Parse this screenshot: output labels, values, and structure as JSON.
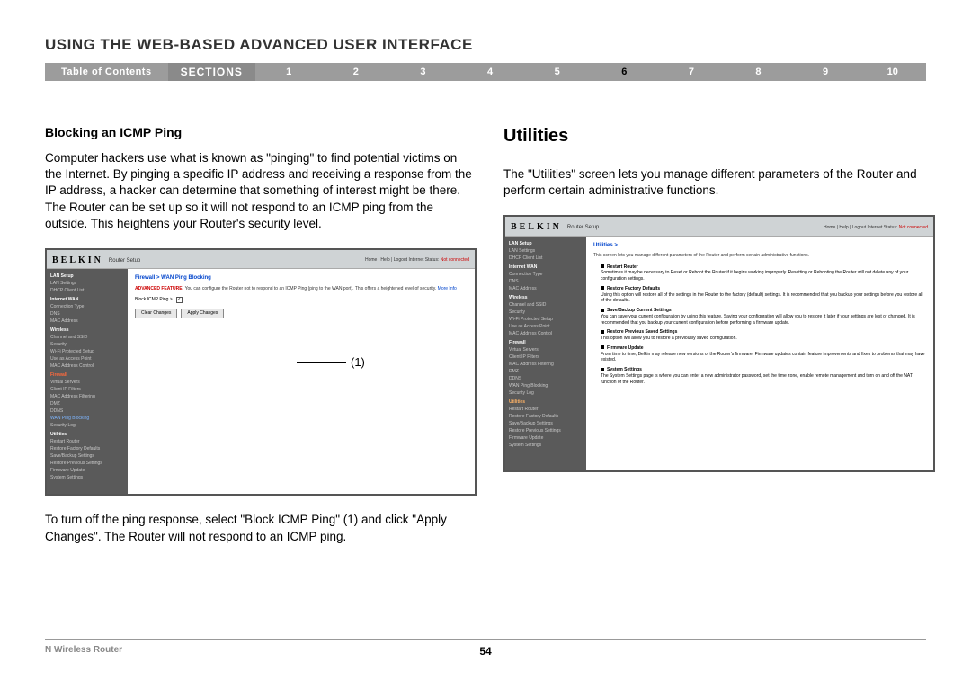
{
  "page_title": "USING THE WEB-BASED ADVANCED USER INTERFACE",
  "nav": {
    "toc": "Table of Contents",
    "sections": "SECTIONS",
    "nums": [
      "1",
      "2",
      "3",
      "4",
      "5",
      "6",
      "7",
      "8",
      "9",
      "10"
    ],
    "current": "6"
  },
  "left": {
    "heading": "Blocking an ICMP Ping",
    "para1": "Computer hackers use what is known as \"pinging\" to find potential victims on the Internet. By pinging a specific IP address and receiving a response from the IP address, a hacker can determine that something of interest might be there. The Router can be set up so it will not respond to an ICMP ping from the outside. This heightens your Router's security level.",
    "para2": "To turn off the ping response, select \"Block ICMP Ping\" (1) and click \"Apply Changes\". The Router will not respond to an ICMP ping.",
    "annot": "(1)"
  },
  "right": {
    "heading": "Utilities",
    "para1": "The \"Utilities\" screen lets you manage different parameters of the Router and perform certain administrative functions."
  },
  "scr_common": {
    "logo": "BELKIN",
    "title": "Router Setup",
    "toplinks": "Home | Help | Logout   Internet Status:",
    "status": "Not connected"
  },
  "scr1": {
    "crumb": "Firewall > WAN Ping Blocking",
    "adv": "ADVANCED FEATURE!",
    "desc": " You can configure the Router not to respond to an ICMP Ping (ping to the WAN port). This offers a heightened level of security. ",
    "more": "More Info",
    "field": "Block ICMP Ping >",
    "btn_clear": "Clear Changes",
    "btn_apply": "Apply Changes",
    "sidebar": {
      "groups": [
        {
          "h": "LAN Setup",
          "items": [
            "LAN Settings",
            "DHCP Client List"
          ]
        },
        {
          "h": "Internet WAN",
          "items": [
            "Connection Type",
            "DNS",
            "MAC Address"
          ]
        },
        {
          "h": "Wireless",
          "items": [
            "Channel and SSID",
            "Security",
            "Wi-Fi Protected Setup",
            "Use as Access Point",
            "MAC Address Control"
          ]
        },
        {
          "h_active": "Firewall",
          "items": [
            "Virtual Servers",
            "Client IP Filters",
            "MAC Address Filtering",
            "DMZ",
            "DDNS"
          ],
          "active_item": "WAN Ping Blocking",
          "items2": [
            "Security Log"
          ]
        },
        {
          "h": "Utilities",
          "items": [
            "Restart Router",
            "Restore Factory Defaults",
            "Save/Backup Settings",
            "Restore Previous Settings",
            "Firmware Update",
            "System Settings"
          ]
        }
      ]
    }
  },
  "scr2": {
    "crumb": "Utilities >",
    "desc": "This screen lets you manage different parameters of the Router and perform certain administrative functions.",
    "items": [
      {
        "b": "Restart Router",
        "d": "Sometimes it may be necessary to Reset or Reboot the Router if it begins working improperly. Resetting or Rebooting the Router will not delete any of your configuration settings."
      },
      {
        "b": "Restore Factory Defaults",
        "d": "Using this option will restore all of the settings in the Router to the factory (default) settings. It is recommended that you backup your settings before you restore all of the defaults."
      },
      {
        "b": "Save/Backup Current Settings",
        "d": "You can save your current configuration by using this feature. Saving your configuration will allow you to restore it later if your settings are lost or changed. It is recommended that you backup your current configuration before performing a firmware update."
      },
      {
        "b": "Restore Previous Saved Settings",
        "d": "This option will allow you to restore a previously saved configuration."
      },
      {
        "b": "Firmware Update",
        "d": "From time to time, Belkin may release new versions of the Router's firmware. Firmware updates contain feature improvements and fixes to problems that may have existed."
      },
      {
        "b": "System Settings",
        "d": "The System Settings page is where you can enter a new administrator password, set the time zone, enable remote management and turn on and off the NAT function of the Router."
      }
    ],
    "sidebar": {
      "groups": [
        {
          "h": "LAN Setup",
          "items": [
            "LAN Settings",
            "DHCP Client List"
          ]
        },
        {
          "h": "Internet WAN",
          "items": [
            "Connection Type",
            "DNS",
            "MAC Address"
          ]
        },
        {
          "h": "Wireless",
          "items": [
            "Channel and SSID",
            "Security",
            "Wi-Fi Protected Setup",
            "Use as Access Point",
            "MAC Address Control"
          ]
        },
        {
          "h": "Firewall",
          "items": [
            "Virtual Servers",
            "Client IP Filters",
            "MAC Address Filtering",
            "DMZ",
            "DDNS",
            "WAN Ping Blocking",
            "Security Log"
          ]
        },
        {
          "h_orange": "Utilities",
          "items": [
            "Restart Router",
            "Restore Factory Defaults",
            "Save/Backup Settings",
            "Restore Previous Settings",
            "Firmware Update",
            "System Settings"
          ]
        }
      ]
    }
  },
  "footer": {
    "left": "N Wireless Router",
    "page": "54"
  }
}
